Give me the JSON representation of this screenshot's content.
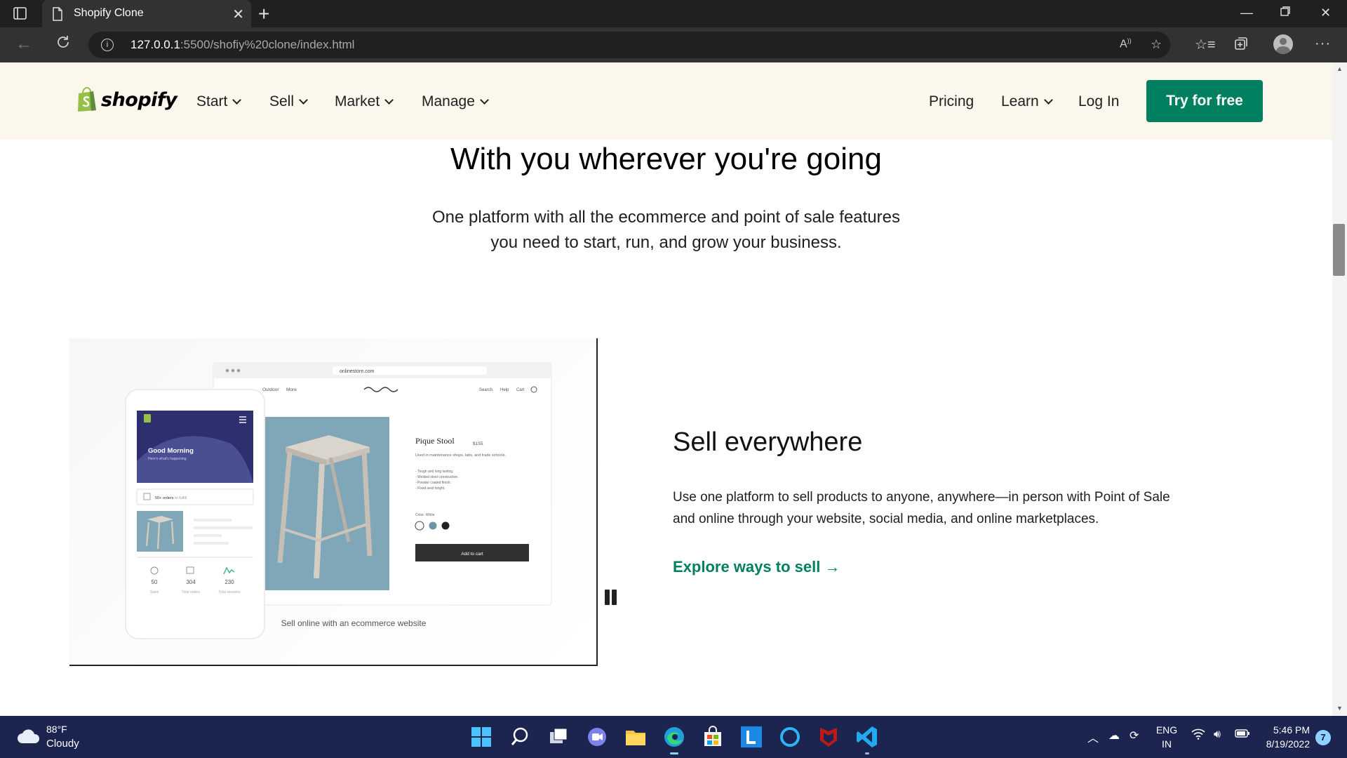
{
  "browser": {
    "tab_title": "Shopify Clone",
    "url_host": "127.0.0.1",
    "url_path": ":5500/shofiy%20clone/index.html"
  },
  "site": {
    "logo_text": "shopify",
    "nav_left": [
      "Start",
      "Sell",
      "Market",
      "Manage"
    ],
    "nav_right": {
      "pricing": "Pricing",
      "learn": "Learn",
      "login": "Log In"
    },
    "cta": "Try for free"
  },
  "hero": {
    "title": "With you wherever you're going",
    "subtitle_line1": "One platform with all the ecommerce and point of sale features",
    "subtitle_line2": "you need to start, run, and grow your business."
  },
  "mockup": {
    "browser_url": "onlinestore.com",
    "store_nav": [
      "Outdoor",
      "More"
    ],
    "store_nav_right": [
      "Search",
      "Help",
      "Cart"
    ],
    "product_name": "Pique Stool",
    "product_price": "$155",
    "product_desc": "Used in maintenance shops, labs, and trade schools.",
    "product_bullets": [
      "- Tough and long lasting.",
      "- Welded steel construction.",
      "- Powder coated finish.",
      "- Fixed seat height."
    ],
    "color_label": "Color: White",
    "add_to_cart": "Add to cart",
    "phone_greeting": "Good Morning",
    "phone_greeting_sub": "Here's what's happening.",
    "phone_orders": "50+ orders",
    "phone_orders_suffix": "to fulfill",
    "stats": [
      {
        "value": "50",
        "label": "Sales"
      },
      {
        "value": "304",
        "label": "Total orders"
      },
      {
        "value": "230",
        "label": "Total sessions"
      }
    ],
    "caption": "Sell online with an ecommerce website"
  },
  "feature": {
    "title": "Sell everywhere",
    "description": "Use one platform to sell products to anyone, anywhere—in person with Point of Sale and online through your website, social media, and online marketplaces.",
    "link": "Explore ways to sell →"
  },
  "taskbar": {
    "temp": "88°F",
    "condition": "Cloudy",
    "lang1": "ENG",
    "lang2": "IN",
    "time": "5:46 PM",
    "date": "8/19/2022",
    "notifications": "7"
  },
  "colors": {
    "brand_green": "#008060",
    "nav_bg": "#fbf7ed",
    "taskbar_bg": "#1b2550"
  }
}
